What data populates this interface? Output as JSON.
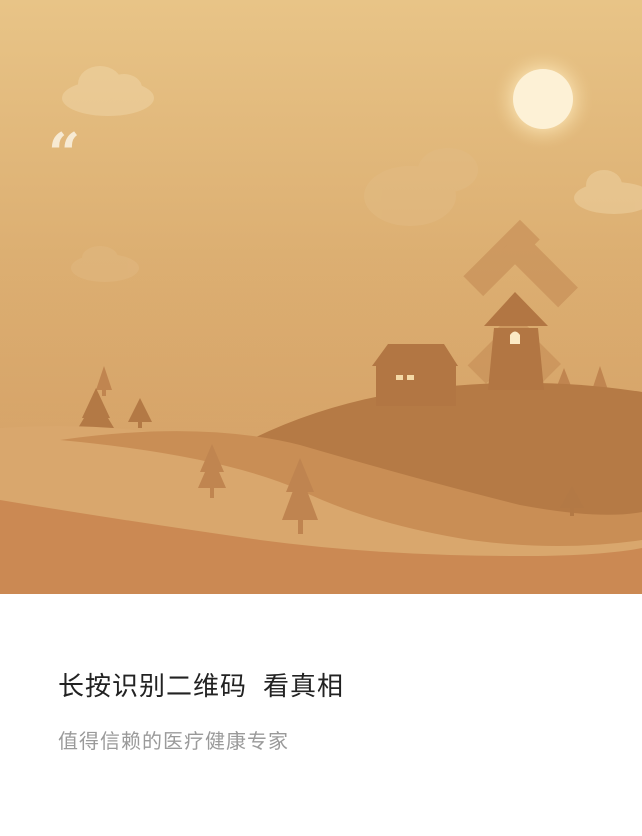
{
  "card": {
    "quote_mark": "“",
    "title_part1": "长按识别二维码",
    "title_part2": "看真相",
    "subtitle": "值得信赖的医疗健康专家"
  },
  "colors": {
    "sky_top": "#e6c086",
    "sky_bottom": "#c98c4f",
    "sun": "#fdf1d6",
    "hill_dark": "#b87a45",
    "hill_light": "#d9a66b",
    "background": "#ffffff",
    "title_text": "#222222",
    "subtitle_text": "#9a9a9a"
  }
}
